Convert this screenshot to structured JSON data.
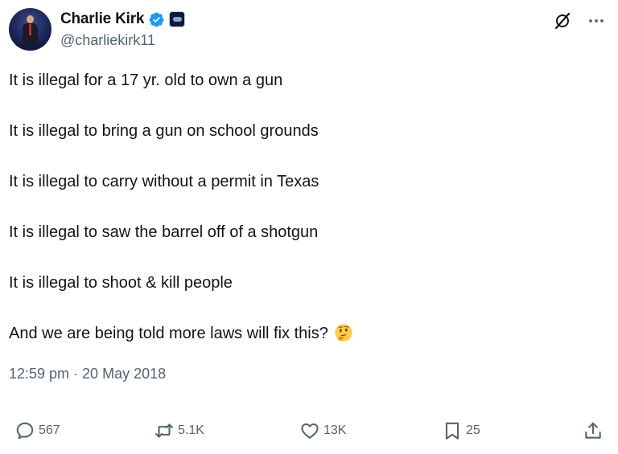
{
  "author": {
    "name": "Charlie Kirk",
    "handle": "@charliekirk11"
  },
  "tweet": {
    "lines": [
      "It is illegal for a 17 yr. old to own a gun",
      "It is illegal to bring a gun on school grounds",
      "It is illegal to carry without a permit in Texas",
      "It is illegal to saw the barrel off of a shotgun",
      "It is illegal to shoot & kill people",
      "And we are being told more laws will fix this?"
    ],
    "emoji": "thinking-face",
    "timestamp": "12:59 pm · 20 May 2018"
  },
  "actions": {
    "replies": "567",
    "reposts": "5.1K",
    "likes": "13K",
    "bookmarks": "25"
  },
  "icons": [
    "verified-badge-icon",
    "affiliation-badge-icon",
    "grok-icon",
    "more-icon",
    "reply-icon",
    "repost-icon",
    "like-icon",
    "bookmark-icon",
    "share-icon"
  ],
  "colors": {
    "text": "#0f1419",
    "secondary": "#536471",
    "verified": "#1d9bf0"
  }
}
